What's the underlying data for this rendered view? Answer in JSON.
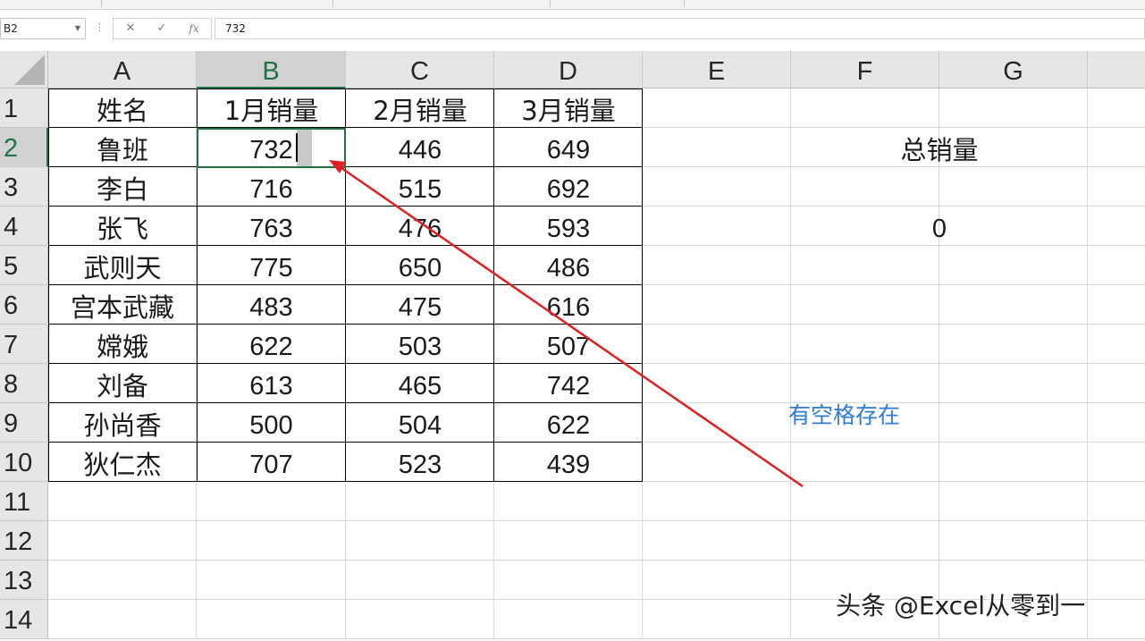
{
  "namebox": {
    "value": "B2"
  },
  "formula_bar": {
    "cancel_glyph": "✕",
    "enter_glyph": "✓",
    "fx_glyph": "fx",
    "content": "732"
  },
  "columns": [
    "A",
    "B",
    "C",
    "D",
    "E",
    "F",
    "G"
  ],
  "rows": [
    "1",
    "2",
    "3",
    "4",
    "5",
    "6",
    "7",
    "8",
    "9",
    "10",
    "11",
    "12",
    "13",
    "14"
  ],
  "table": {
    "headers": [
      "姓名",
      "1月销量",
      "2月销量",
      "3月销量"
    ],
    "body": [
      [
        "鲁班",
        "732",
        "446",
        "649"
      ],
      [
        "李白",
        "716",
        "515",
        "692"
      ],
      [
        "张飞",
        "763",
        "476",
        "593"
      ],
      [
        "武则天",
        "775",
        "650",
        "486"
      ],
      [
        "宫本武藏",
        "483",
        "475",
        "616"
      ],
      [
        "嫦娥",
        "622",
        "503",
        "507"
      ],
      [
        "刘备",
        "613",
        "465",
        "742"
      ],
      [
        "孙尚香",
        "500",
        "504",
        "622"
      ],
      [
        "狄仁杰",
        "707",
        "523",
        "439"
      ]
    ]
  },
  "summary": {
    "label": "总销量",
    "value": "0"
  },
  "annotation": {
    "text": "有空格存在",
    "color": "#2f7bd6"
  },
  "arrow_color": "#e02020",
  "selection": {
    "cell": "B2",
    "accent": "#217346"
  },
  "watermark": "头条 @Excel从零到一"
}
